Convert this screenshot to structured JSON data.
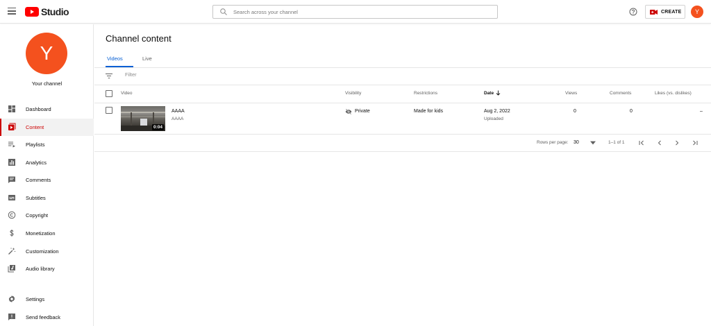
{
  "app": {
    "logo_text": "Studio",
    "search_placeholder": "Search across your channel",
    "create_label": "CREATE",
    "avatar_letter": "Y",
    "accent_color": "#cc0000",
    "avatar_color": "#f4511e",
    "link_color": "#065fd4"
  },
  "sidebar": {
    "avatar_letter": "Y",
    "channel_label": "Your channel",
    "items": [
      {
        "label": "Dashboard",
        "icon": "dashboard-icon"
      },
      {
        "label": "Content",
        "icon": "content-icon",
        "active": true
      },
      {
        "label": "Playlists",
        "icon": "playlists-icon"
      },
      {
        "label": "Analytics",
        "icon": "analytics-icon"
      },
      {
        "label": "Comments",
        "icon": "comments-icon"
      },
      {
        "label": "Subtitles",
        "icon": "subtitles-icon"
      },
      {
        "label": "Copyright",
        "icon": "copyright-icon"
      },
      {
        "label": "Monetization",
        "icon": "dollar-icon"
      },
      {
        "label": "Customization",
        "icon": "magic-wand-icon"
      },
      {
        "label": "Audio library",
        "icon": "audio-library-icon"
      }
    ],
    "bottom_items": [
      {
        "label": "Settings",
        "icon": "gear-icon"
      },
      {
        "label": "Send feedback",
        "icon": "feedback-icon"
      }
    ]
  },
  "main": {
    "title": "Channel content",
    "tabs": [
      {
        "label": "Videos",
        "active": true
      },
      {
        "label": "Live",
        "active": false
      }
    ],
    "filter_placeholder": "Filter",
    "columns": {
      "video": "Video",
      "visibility": "Visibility",
      "restrictions": "Restrictions",
      "date": "Date",
      "views": "Views",
      "comments": "Comments",
      "likes": "Likes (vs. dislikes)"
    },
    "rows": [
      {
        "title": "AAAA",
        "description": "AAAA",
        "duration": "0:04",
        "visibility": "Private",
        "restrictions": "Made for kids",
        "date": "Aug 2, 2022",
        "date_status": "Uploaded",
        "views": "0",
        "comments": "0",
        "likes": "–"
      }
    ],
    "pagination": {
      "rows_per_page_label": "Rows per page:",
      "rows_per_page": "30",
      "range": "1–1 of 1"
    }
  }
}
